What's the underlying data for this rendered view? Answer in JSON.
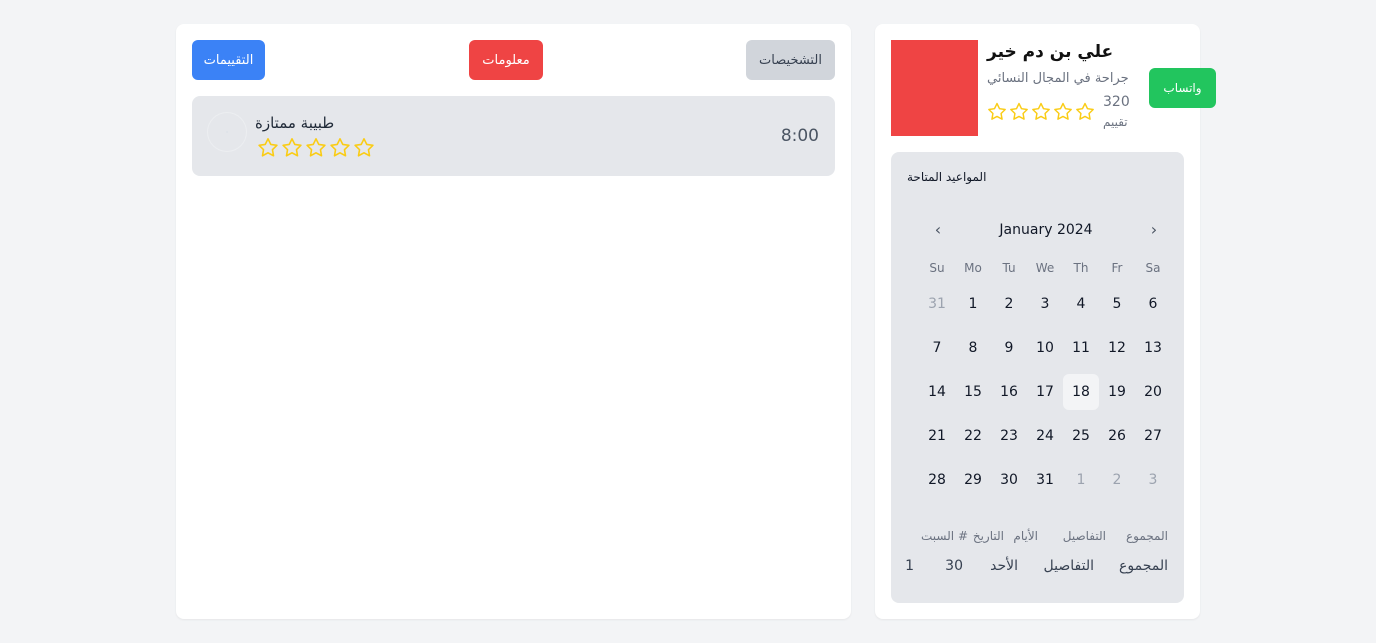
{
  "tabs": {
    "reviews": "التقييمات",
    "info": "معلومات",
    "diagnoses": "التشخيصات"
  },
  "review": {
    "time": "8:00",
    "avatar_placeholder": "·",
    "text": "طبيبة ممتازة",
    "stars": 5
  },
  "doctor": {
    "name": "علي بن دم خير",
    "specialty": "جراحة في المجال النسائي",
    "rating_count": "320",
    "rating_label": "تقييم",
    "stars": 5,
    "whatsapp_label": "واتساب",
    "photo_color": "#ef4444"
  },
  "appointments": {
    "title": "المواعيد المتاحة",
    "calendar": {
      "month_label": "January 2024",
      "prev_icon": "chevron-left-icon",
      "next_icon": "chevron-right-icon",
      "weekdays": [
        "Su",
        "Mo",
        "Tu",
        "We",
        "Th",
        "Fr",
        "Sa"
      ],
      "weeks": [
        [
          "31",
          "1",
          "2",
          "3",
          "4",
          "5",
          "6"
        ],
        [
          "7",
          "8",
          "9",
          "10",
          "11",
          "12",
          "13"
        ],
        [
          "14",
          "15",
          "16",
          "17",
          "18",
          "19",
          "20"
        ],
        [
          "21",
          "22",
          "23",
          "24",
          "25",
          "26",
          "27"
        ],
        [
          "28",
          "29",
          "30",
          "31",
          "1",
          "2",
          "3"
        ]
      ],
      "selected_day": "18"
    },
    "table": {
      "headers": [
        "المجموع",
        "التفاصيل",
        "الأيام",
        "التاريخ",
        "السبت #"
      ],
      "row": [
        "المجموع",
        "التفاصيل",
        "الأحد",
        "30",
        "1"
      ]
    }
  },
  "colors": {
    "primary": "#3b82f6",
    "danger": "#ef4444",
    "success": "#22c55e",
    "star": "#facc15"
  }
}
